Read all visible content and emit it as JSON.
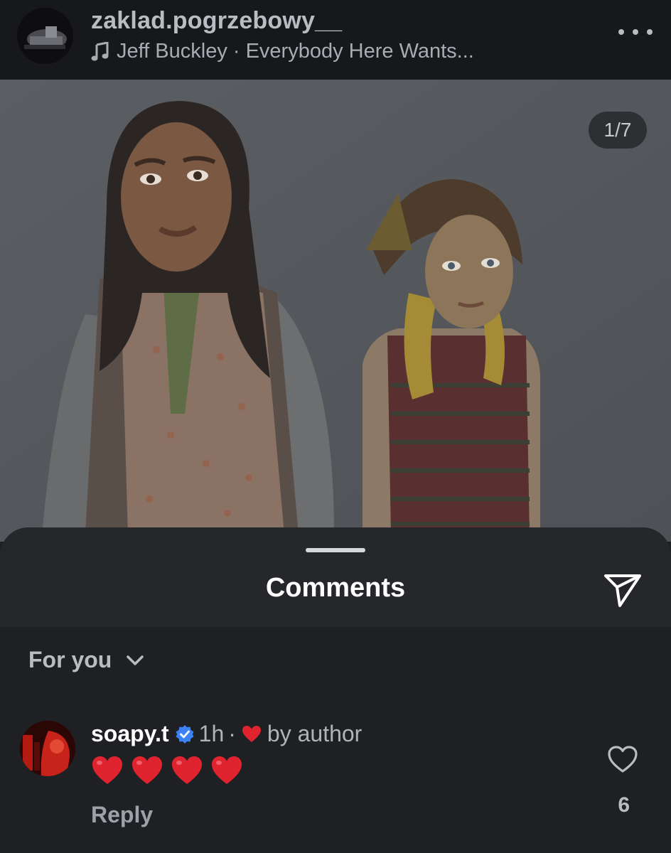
{
  "post": {
    "username": "zaklad.pogrzebowy__",
    "music": "Jeff Buckley · Everybody Here Wants...",
    "image_counter": "1/7"
  },
  "icons": {
    "music": "music-note-icon",
    "more": "more-horizontal-icon",
    "share": "paper-plane-icon",
    "filter": "chevron-down-icon",
    "verified": "verified-badge-icon",
    "like": "heart-outline-icon"
  },
  "colors": {
    "background": "#1e2024",
    "sheet_header": "#25272b",
    "verified_blue": "#3b82f6",
    "heart_red": "#e0242f"
  },
  "comments_sheet": {
    "title": "Comments",
    "filter_label": "For you"
  },
  "comments": [
    {
      "username": "soapy.t",
      "time": "1h",
      "separator": "·",
      "liked_by": "by author",
      "text": "❤️❤️❤️❤️",
      "reply_label": "Reply",
      "like_count": "6"
    }
  ]
}
